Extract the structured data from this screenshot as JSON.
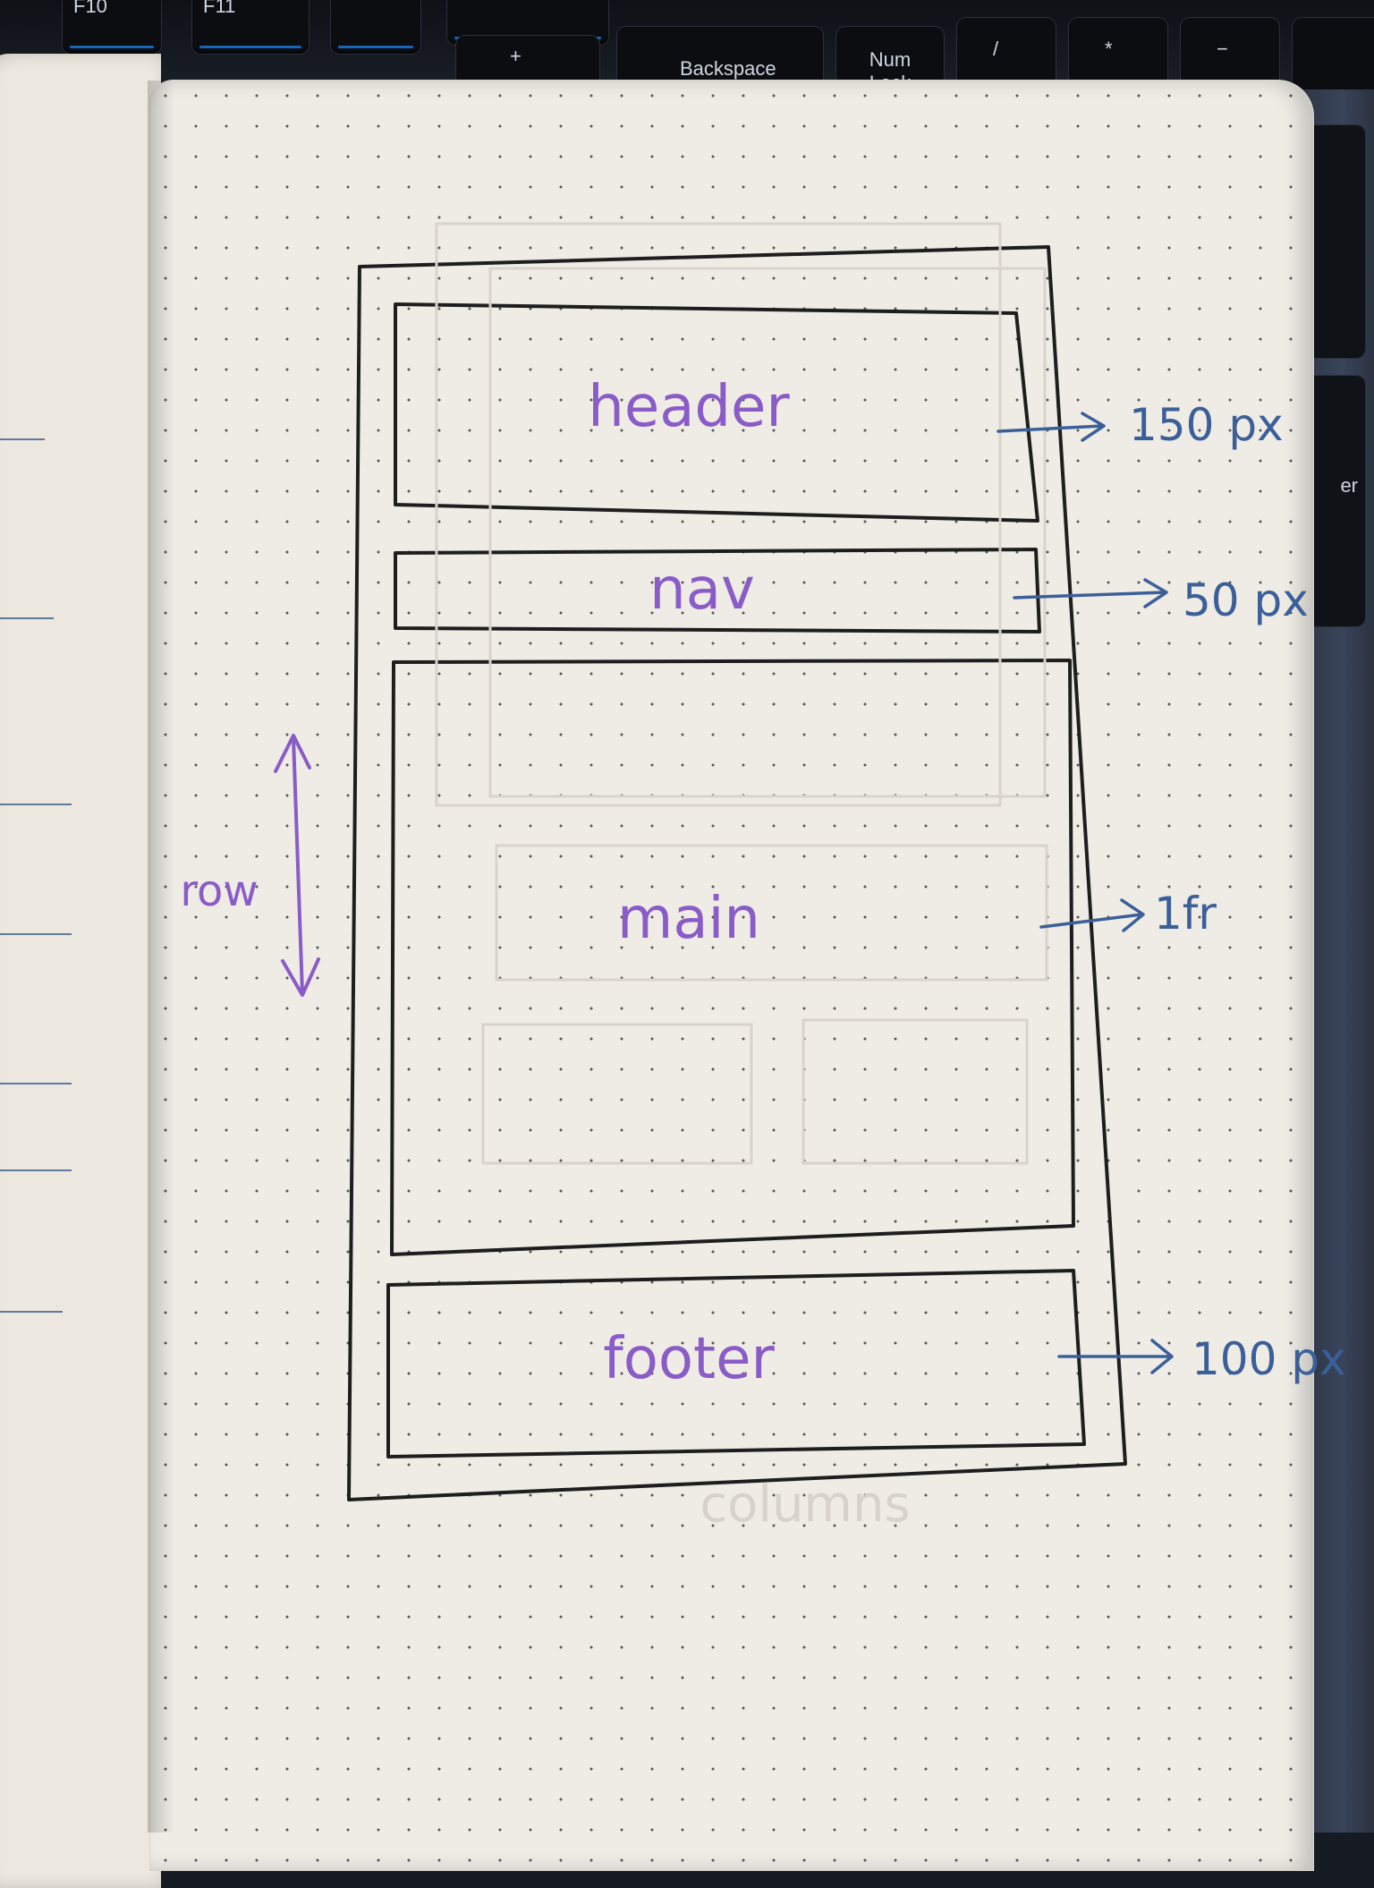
{
  "keyboard": {
    "keys": [
      "F10",
      "F11",
      "Backspace",
      "Num Lock",
      "/",
      "*",
      "−",
      "+"
    ],
    "side_key": "er"
  },
  "sketch": {
    "regions": [
      {
        "label": "header",
        "size": "150 px"
      },
      {
        "label": "nav",
        "size": "50 px"
      },
      {
        "label": "main",
        "size": "1fr"
      },
      {
        "label": "footer",
        "size": "100 px"
      }
    ],
    "axis_label": "row",
    "faint_text": "columns"
  },
  "colors": {
    "ink": "#1e1e1e",
    "label_purple": "#8a5cc7",
    "annotation_blue": "#3b5f99",
    "page": "#efece6"
  }
}
